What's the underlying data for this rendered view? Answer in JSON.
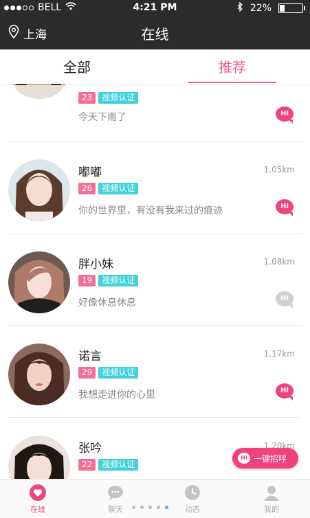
{
  "status": {
    "carrier": "BELL",
    "time": "4:21 PM",
    "battery": "22%",
    "battery_level": 0.22
  },
  "nav": {
    "location": "上海",
    "title": "在线"
  },
  "tabs": {
    "all": "全部",
    "recommended": "推荐"
  },
  "users": [
    {
      "name": "",
      "age": "23",
      "verified": "视频认证",
      "distance": "",
      "signature": "今天下雨了",
      "hi_active": true
    },
    {
      "name": "嘟嘟",
      "age": "26",
      "verified": "视频认证",
      "distance": "1.05km",
      "signature": "你的世界里，有没有我来过的痕迹",
      "hi_active": true
    },
    {
      "name": "胖小妹",
      "age": "19",
      "verified": "视频认证",
      "distance": "1.08km",
      "signature": "好像休息休息",
      "hi_active": false
    },
    {
      "name": "诺言",
      "age": "29",
      "verified": "视频认证",
      "distance": "1.17km",
      "signature": "我想走进你的心里",
      "hi_active": true
    },
    {
      "name": "张吟",
      "age": "22",
      "verified": "视频认证",
      "distance": "1.20km",
      "signature": "",
      "hi_active": true
    }
  ],
  "hi_label": "HI",
  "greet_button": "一键招呼",
  "tabbar": {
    "online": "在线",
    "chat": "聊天",
    "moments": "动态",
    "mine": "我的"
  },
  "colors": {
    "accent": "#f0437b",
    "age_badge": "#f46f95",
    "verify_badge": "#3fd1dc",
    "header_bg": "#2b2b2b"
  }
}
